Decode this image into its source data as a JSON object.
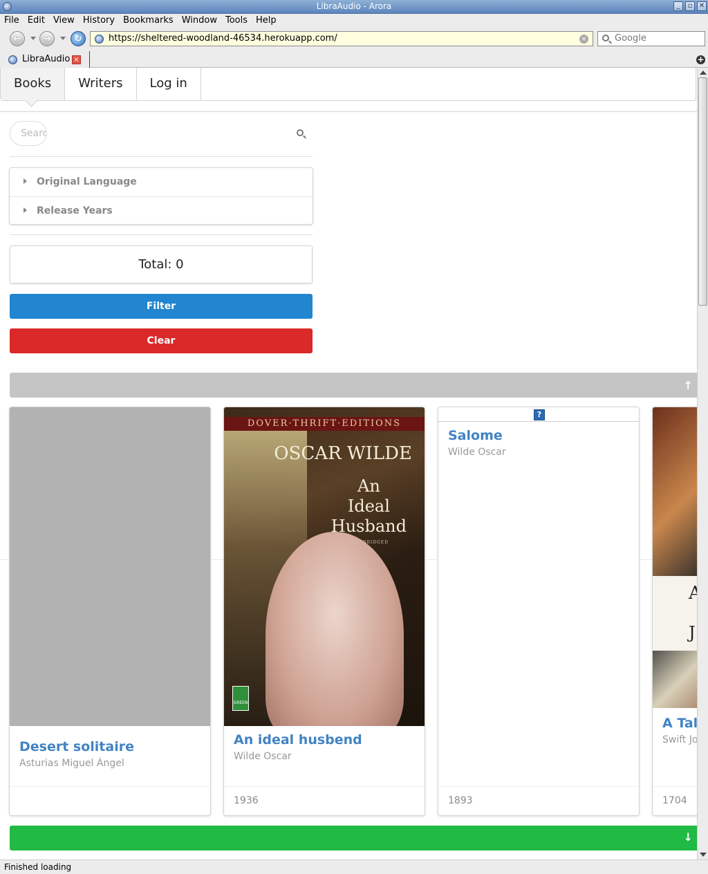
{
  "window": {
    "title": "LibraAudio - Arora",
    "controls": [
      "_",
      "▫",
      "✕"
    ]
  },
  "menu": [
    "File",
    "Edit",
    "View",
    "History",
    "Bookmarks",
    "Window",
    "Tools",
    "Help"
  ],
  "toolbar": {
    "url": "https://sheltered-woodland-46534.herokuapp.com/",
    "search_placeholder": "Google"
  },
  "tab": {
    "label": "LibraAudio"
  },
  "site_nav": {
    "books": "Books",
    "writers": "Writers",
    "login": "Log in"
  },
  "filters": {
    "search_placeholder": "Search",
    "search_visible": "Searc",
    "accordion": [
      "Original Language",
      "Release Years"
    ],
    "total": "Total: 0",
    "filter_button": "Filter",
    "clear_button": "Clear"
  },
  "books": [
    {
      "title": "Desert solitaire",
      "author": "Asturias Miguel Ángel",
      "year": ""
    },
    {
      "title": "An ideal husbend",
      "author": "Wilde Oscar",
      "year": "1936"
    },
    {
      "title": "Salome",
      "author": "Wilde Oscar",
      "year": "1893"
    },
    {
      "title": "A Tal",
      "author": "Swift Jo",
      "year": "1704"
    }
  ],
  "cover_text": {
    "band": "DOVER·THRIFT·EDITIONS",
    "author": "OSCAR WILDE",
    "title_lines": [
      "An",
      "Ideal",
      "Husband"
    ],
    "unabridged": "UNABRIDGED",
    "badge": "GREEN EDITION",
    "art_letter_1": "A",
    "art_letter_2": "J"
  },
  "status": "Finished loading",
  "colors": {
    "filter": "#2185d0",
    "clear": "#db2828",
    "scroll_up_bar": "#c5c5c5",
    "scroll_down_bar": "#21ba45",
    "link": "#4183c4"
  },
  "icons": {
    "back": "arrow-left-icon",
    "forward": "arrow-right-icon",
    "reload": "reload-icon",
    "search": "search-icon",
    "scroll_up": "arrow-up-icon",
    "scroll_down": "arrow-down-icon"
  }
}
